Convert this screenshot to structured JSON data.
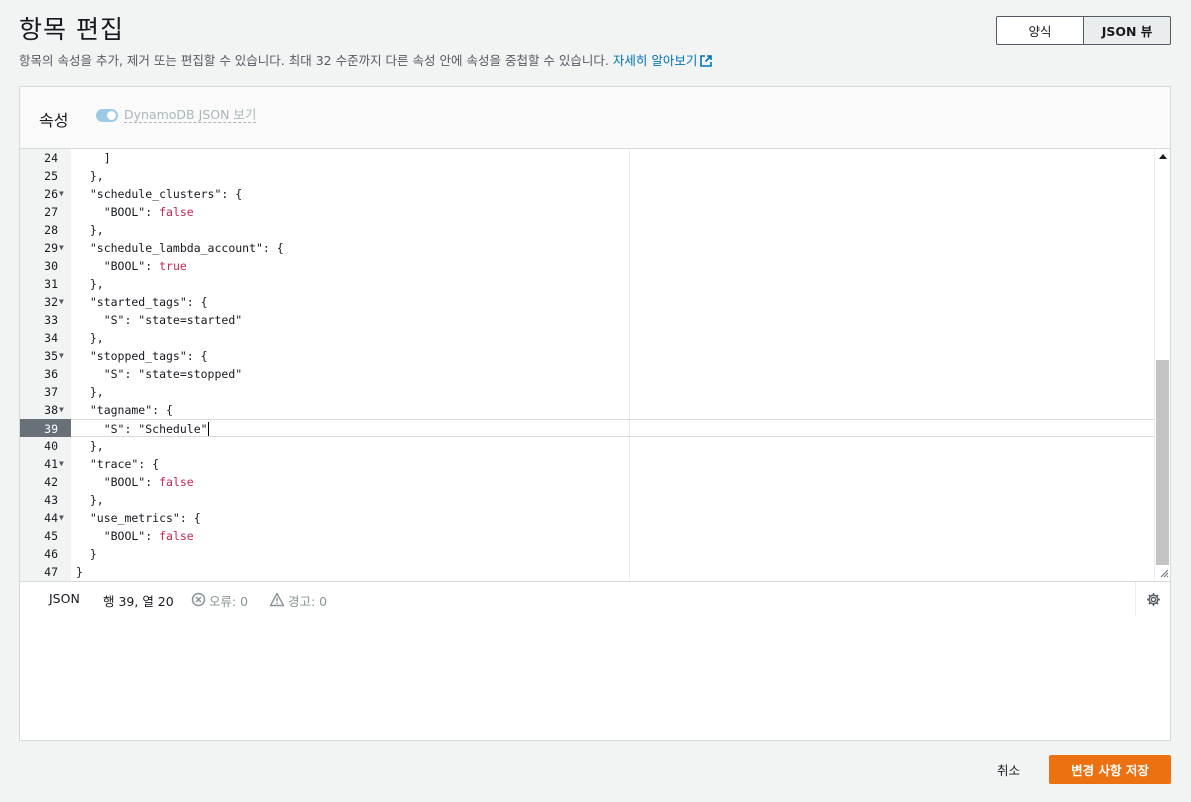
{
  "header": {
    "title": "항목 편집",
    "description": "항목의 속성을 추가, 제거 또는 편집할 수 있습니다. 최대 32 수준까지 다른 속성 안에 속성을 중첩할 수 있습니다.",
    "learn_more": "자세히 알아보기"
  },
  "view_toggle": {
    "form_label": "양식",
    "json_label": "JSON 뷰",
    "selected": "JSON 뷰"
  },
  "panel": {
    "title": "속성",
    "dynamodb_json_toggle": "DynamoDB JSON 보기",
    "toggle_on": true
  },
  "editor": {
    "active_line": 39,
    "lines": [
      {
        "n": "24",
        "fold": false,
        "code": "    ]"
      },
      {
        "n": "25",
        "fold": false,
        "code": "  },"
      },
      {
        "n": "26",
        "fold": true,
        "code": "  \"schedule_clusters\": {"
      },
      {
        "n": "27",
        "fold": false,
        "code": "    \"BOOL\": false"
      },
      {
        "n": "28",
        "fold": false,
        "code": "  },"
      },
      {
        "n": "29",
        "fold": true,
        "code": "  \"schedule_lambda_account\": {"
      },
      {
        "n": "30",
        "fold": false,
        "code": "    \"BOOL\": true"
      },
      {
        "n": "31",
        "fold": false,
        "code": "  },"
      },
      {
        "n": "32",
        "fold": true,
        "code": "  \"started_tags\": {"
      },
      {
        "n": "33",
        "fold": false,
        "code": "    \"S\": \"state=started\""
      },
      {
        "n": "34",
        "fold": false,
        "code": "  },"
      },
      {
        "n": "35",
        "fold": true,
        "code": "  \"stopped_tags\": {"
      },
      {
        "n": "36",
        "fold": false,
        "code": "    \"S\": \"state=stopped\""
      },
      {
        "n": "37",
        "fold": false,
        "code": "  },"
      },
      {
        "n": "38",
        "fold": true,
        "code": "  \"tagname\": {"
      },
      {
        "n": "39",
        "fold": false,
        "code": "    \"S\": \"Schedule\""
      },
      {
        "n": "40",
        "fold": false,
        "code": "  },"
      },
      {
        "n": "41",
        "fold": true,
        "code": "  \"trace\": {"
      },
      {
        "n": "42",
        "fold": false,
        "code": "    \"BOOL\": false"
      },
      {
        "n": "43",
        "fold": false,
        "code": "  },"
      },
      {
        "n": "44",
        "fold": true,
        "code": "  \"use_metrics\": {"
      },
      {
        "n": "45",
        "fold": false,
        "code": "    \"BOOL\": false"
      },
      {
        "n": "46",
        "fold": false,
        "code": "  }"
      },
      {
        "n": "47",
        "fold": false,
        "code": "}"
      }
    ]
  },
  "status": {
    "mode": "JSON",
    "position": "행 39, 열 20",
    "errors": "오류: 0",
    "warnings": "경고: 0"
  },
  "footer": {
    "cancel_label": "취소",
    "save_label": "변경 사항 저장"
  },
  "colors": {
    "primary_button": "#ec7211",
    "link": "#0073bb",
    "boolean_value": "#c7254e"
  }
}
